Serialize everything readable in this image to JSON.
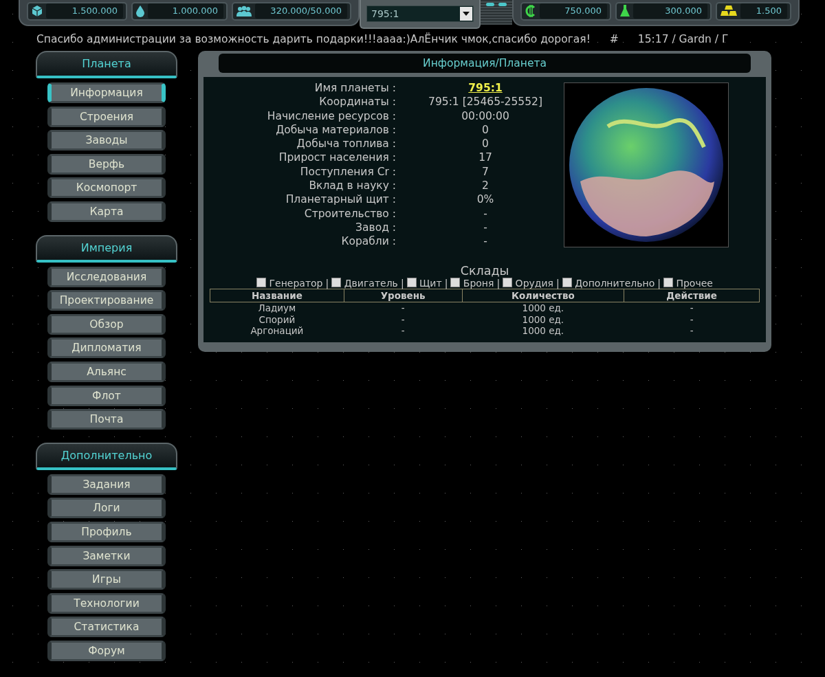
{
  "top_bar": {
    "resources_left": [
      {
        "kind": "cube",
        "value": "1.500.000"
      },
      {
        "kind": "drop",
        "value": "1.000.000"
      },
      {
        "kind": "people",
        "value": "320.000/50.000"
      }
    ],
    "planet_select": {
      "value": "795:1"
    },
    "resources_right": [
      {
        "kind": "credit",
        "value": "750.000"
      },
      {
        "kind": "flask",
        "value": "300.000"
      },
      {
        "kind": "gold",
        "value": "1.500"
      }
    ]
  },
  "ticker": {
    "message": "Спасибо администрации за возможность дарить подарки!!!аааа:)АлЁнчик чмок,спасибо дорогая!",
    "hash": "#",
    "status": "15:17 / Gardn / Г"
  },
  "sidebar": {
    "sections": [
      {
        "title": "Планета",
        "items": [
          {
            "label": "Информация",
            "selected": true
          },
          {
            "label": "Строения",
            "selected": false
          },
          {
            "label": "Заводы",
            "selected": false
          },
          {
            "label": "Верфь",
            "selected": false
          },
          {
            "label": "Космопорт",
            "selected": false
          },
          {
            "label": "Карта",
            "selected": false
          }
        ]
      },
      {
        "title": "Империя",
        "items": [
          {
            "label": "Исследования",
            "selected": false
          },
          {
            "label": "Проектирование",
            "selected": false
          },
          {
            "label": "Обзор",
            "selected": false
          },
          {
            "label": "Дипломатия",
            "selected": false
          },
          {
            "label": "Альянс",
            "selected": false
          },
          {
            "label": "Флот",
            "selected": false
          },
          {
            "label": "Почта",
            "selected": false
          }
        ]
      },
      {
        "title": "Дополнительно",
        "items": [
          {
            "label": "Задания",
            "selected": false
          },
          {
            "label": "Логи",
            "selected": false
          },
          {
            "label": "Профиль",
            "selected": false
          },
          {
            "label": "Заметки",
            "selected": false
          },
          {
            "label": "Игры",
            "selected": false
          },
          {
            "label": "Технологии",
            "selected": false
          },
          {
            "label": "Статистика",
            "selected": false
          },
          {
            "label": "Форум",
            "selected": false
          }
        ]
      }
    ]
  },
  "panel": {
    "title": "Информация/Планета",
    "info": [
      {
        "label": "Имя планеты :",
        "value": "795:1",
        "kind": "link"
      },
      {
        "label": "Координаты :",
        "value": "795:1 [25465-25552]",
        "kind": "text"
      },
      {
        "label": "Начисление ресурсов :",
        "value": "00:00:00",
        "kind": "text"
      },
      {
        "label": "Добыча материалов :",
        "value": "0",
        "kind": "text"
      },
      {
        "label": "Добыча топлива :",
        "value": "0",
        "kind": "text"
      },
      {
        "label": "Прирост населения :",
        "value": "17",
        "kind": "text"
      },
      {
        "label": "Поступления Cr :",
        "value": "7",
        "kind": "text"
      },
      {
        "label": "Вклад в науку :",
        "value": "2",
        "kind": "text"
      },
      {
        "label": "Планетарный щит :",
        "value": "0%",
        "kind": "text"
      },
      {
        "label": "Строительство :",
        "value": "-",
        "kind": "text"
      },
      {
        "label": "Завод :",
        "value": "-",
        "kind": "text"
      },
      {
        "label": "Корабли :",
        "value": "-",
        "kind": "text"
      }
    ],
    "storage": {
      "title": "Склады",
      "filters": [
        {
          "label": "Генератор",
          "checked": false
        },
        {
          "label": "Двигатель",
          "checked": false
        },
        {
          "label": "Щит",
          "checked": false
        },
        {
          "label": "Броня",
          "checked": false
        },
        {
          "label": "Орудия",
          "checked": false
        },
        {
          "label": "Дополнительно",
          "checked": false
        },
        {
          "label": "Прочее",
          "checked": false
        }
      ],
      "separator": "|",
      "columns": [
        "Название",
        "Уровень",
        "Количество",
        "Действие"
      ],
      "rows": [
        [
          "Ладиум",
          "-",
          "1000 ед.",
          "-"
        ],
        [
          "Спорий",
          "-",
          "1000 ед.",
          "-"
        ],
        [
          "Аргонаций",
          "-",
          "1000 ед.",
          "-"
        ]
      ]
    }
  }
}
